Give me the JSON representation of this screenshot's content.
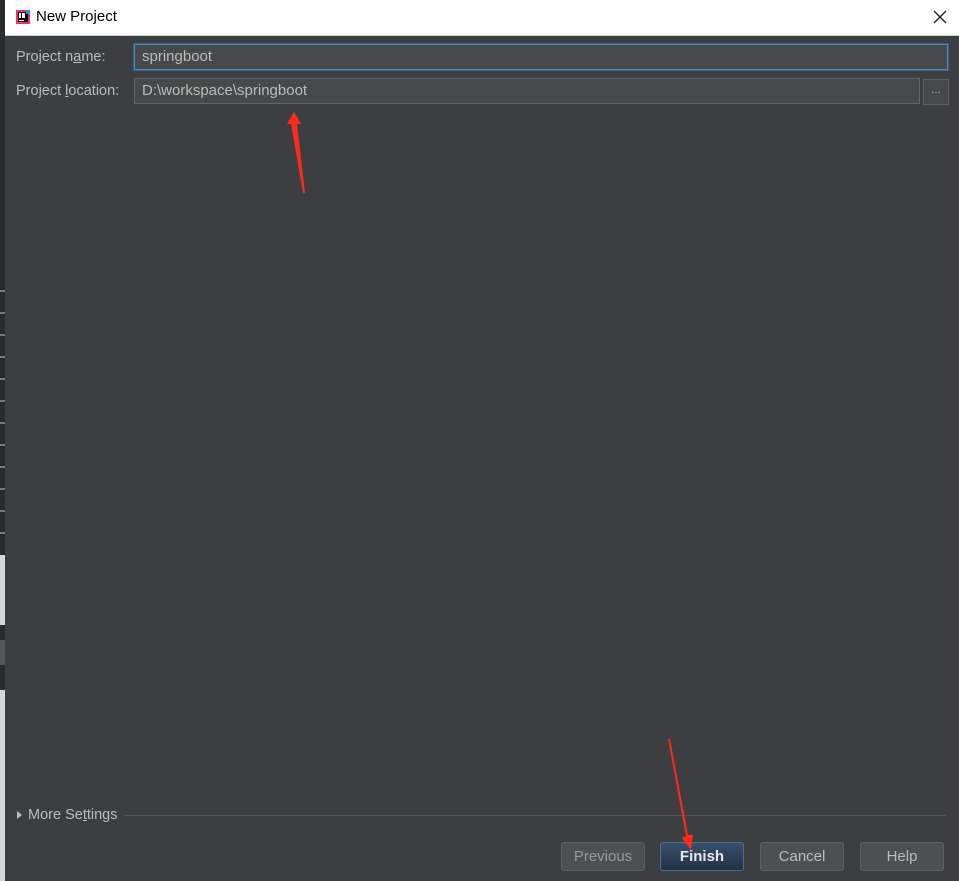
{
  "window": {
    "title": "New Project",
    "app_icon": "intellij-idea-icon",
    "close_icon": "close-icon"
  },
  "form": {
    "project_name": {
      "label_pre": "Project n",
      "label_mnemonic": "a",
      "label_post": "me:",
      "value": "springboot"
    },
    "project_location": {
      "label_pre": "Project ",
      "label_mnemonic": "l",
      "label_post": "ocation:",
      "value": "D:\\workspace\\springboot",
      "browse_label": "..."
    }
  },
  "more_settings": {
    "label_pre": "More Se",
    "label_mnemonic": "t",
    "label_post": "tings",
    "icon": "triangle-right-icon"
  },
  "buttons": {
    "previous": "Previous",
    "finish": "Finish",
    "cancel": "Cancel",
    "help": "Help"
  },
  "colors": {
    "dialog_bg": "#3c3f41",
    "field_bg": "#45494a",
    "focus_border": "#4a88c7",
    "annotation_arrow": "#ff2a1a",
    "default_button": "#2f4560"
  }
}
